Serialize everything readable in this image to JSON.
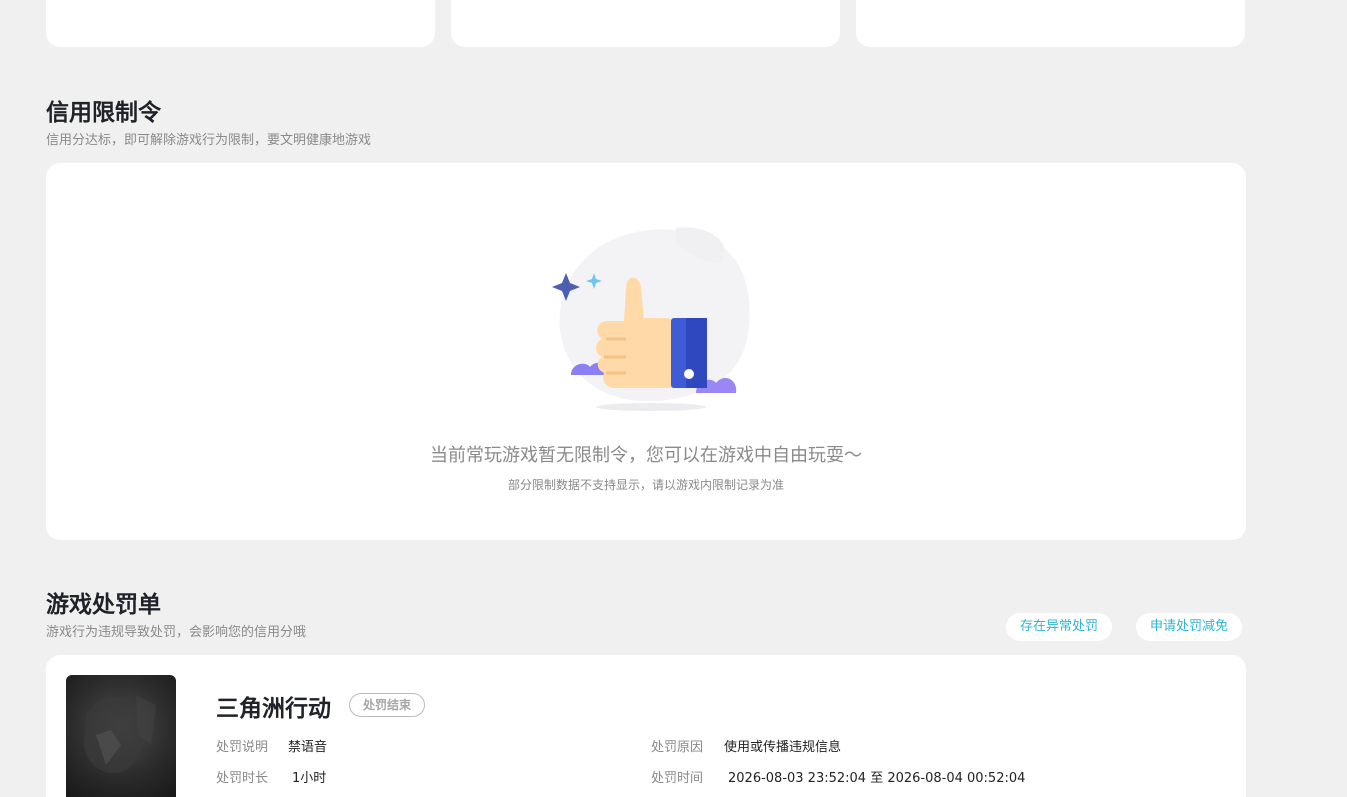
{
  "credit_section": {
    "title": "信用限制令",
    "subtitle": "信用分达标，即可解除游戏行为限制，要文明健康地游戏",
    "empty_message": "当前常玩游戏暂无限制令，您可以在游戏中自由玩耍～",
    "empty_note": "部分限制数据不支持显示，请以游戏内限制记录为准"
  },
  "penalty_section": {
    "title": "游戏处罚单",
    "subtitle": "游戏行为违规导致处罚，会影响您的信用分哦",
    "actions": {
      "abnormal_label": "存在异常处罚",
      "appeal_label": "申请处罚减免"
    },
    "record": {
      "game_name": "三角洲行动",
      "status": "处罚结束",
      "desc_label": "处罚说明",
      "desc_value": "禁语音",
      "reason_label": "处罚原因",
      "reason_value": "使用或传播违规信息",
      "duration_label": "处罚时长",
      "duration_value": "1小时",
      "time_label": "处罚时间",
      "time_value": "2026-08-03 23:52:04 至 2026-08-04 00:52:04"
    }
  },
  "colors": {
    "accent": "#2fb4d6",
    "background": "#f0f0f0",
    "thumb_blue": "#3f5bd6",
    "thumb_skin": "#ffd9a8"
  }
}
